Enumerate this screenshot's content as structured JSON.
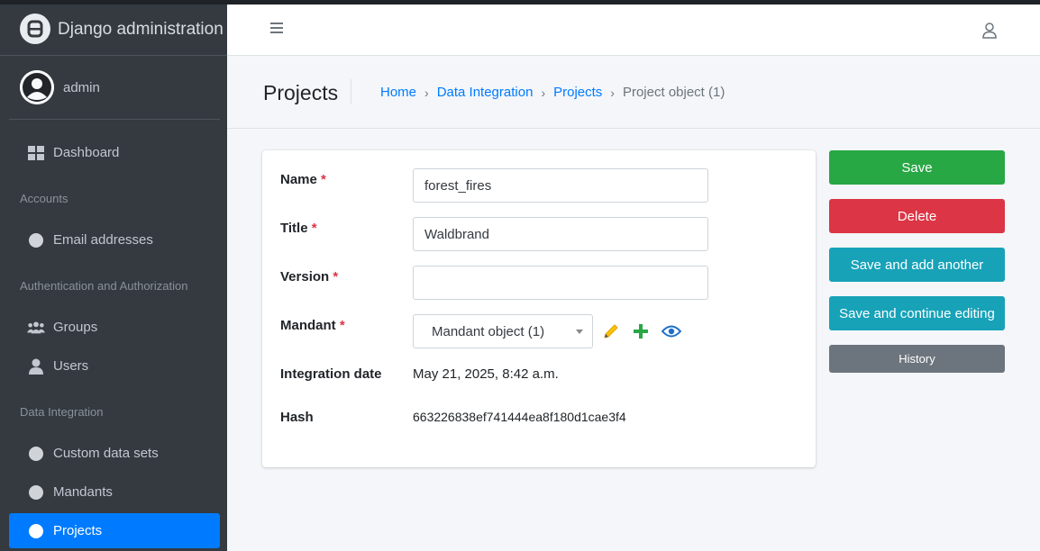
{
  "brand": {
    "title": "Django administration",
    "logo_icon": "django-logo-icon"
  },
  "user_panel": {
    "name": "admin"
  },
  "sidebar": {
    "dashboard": "Dashboard",
    "sections": [
      {
        "header": "Accounts",
        "items": [
          "Email addresses"
        ]
      },
      {
        "header": "Authentication and Authorization",
        "items": [
          "Groups",
          "Users"
        ]
      },
      {
        "header": "Data Integration",
        "items": [
          "Custom data sets",
          "Mandants",
          "Projects"
        ]
      }
    ],
    "active_item": "Projects",
    "active_color": "#007bff"
  },
  "header": {
    "menu_icon": "hamburger-icon",
    "user_icon": "user-icon"
  },
  "page": {
    "title": "Projects",
    "breadcrumb": [
      "Home",
      "Data Integration",
      "Projects",
      "Project object (1)"
    ]
  },
  "form": {
    "name": {
      "label": "Name",
      "required": "*",
      "value": "forest_fires"
    },
    "title": {
      "label": "Title",
      "required": "*",
      "value": "Waldbrand"
    },
    "version": {
      "label": "Version",
      "required": "*",
      "value": ""
    },
    "mandant": {
      "label": "Mandant",
      "required": "*",
      "selected": "Mandant object (1)"
    },
    "integration_date": {
      "label": "Integration date",
      "value": "May 21, 2025, 8:42 a.m."
    },
    "hash": {
      "label": "Hash",
      "value": "663226838ef741444ea8f180d1cae3f4"
    }
  },
  "actions": {
    "save": "Save",
    "delete": "Delete",
    "save_add": "Save and add another",
    "save_continue": "Save and continue editing",
    "history": "History"
  },
  "colors": {
    "save": "#28a745",
    "delete": "#dc3545",
    "info": "#17a2b8",
    "history": "#6c757d",
    "link": "#007bff"
  }
}
